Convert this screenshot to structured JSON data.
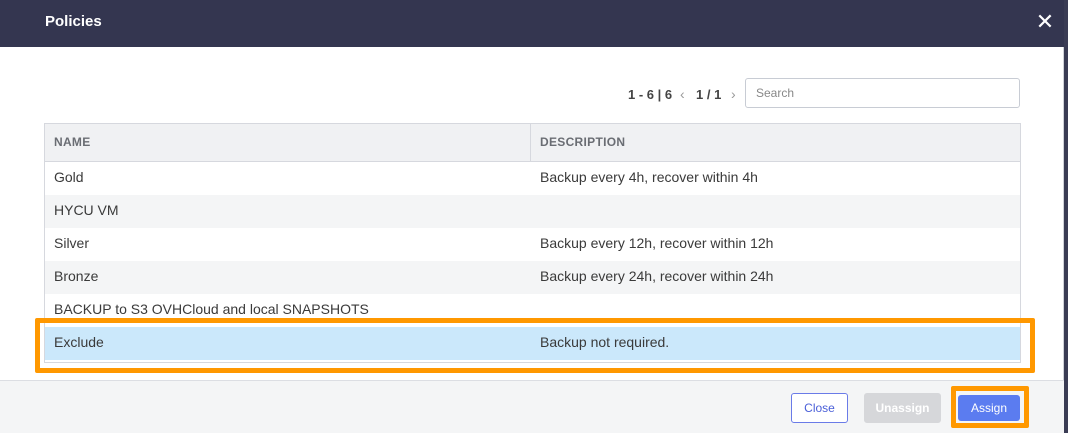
{
  "dialog": {
    "title": "Policies",
    "close_glyph": "✕"
  },
  "pager": {
    "range": "1 - 6 | 6",
    "prev_glyph": "‹",
    "page": "1 / 1",
    "next_glyph": "›"
  },
  "search": {
    "placeholder": "Search",
    "value": ""
  },
  "table": {
    "columns": [
      "NAME",
      "DESCRIPTION"
    ],
    "rows": [
      {
        "name": "Gold",
        "description": "Backup every 4h, recover within 4h"
      },
      {
        "name": "HYCU VM",
        "description": ""
      },
      {
        "name": "Silver",
        "description": "Backup every 12h, recover within 12h"
      },
      {
        "name": "Bronze",
        "description": "Backup every 24h, recover within 24h"
      },
      {
        "name": "BACKUP to S3 OVHCloud and local SNAPSHOTS",
        "description": ""
      },
      {
        "name": "Exclude",
        "description": "Backup not required."
      }
    ],
    "selected_index": 5
  },
  "footer": {
    "close_label": "Close",
    "unassign_label": "Unassign",
    "assign_label": "Assign"
  },
  "colors": {
    "header_bg": "#343650",
    "selected_row": "#cbe8fb",
    "highlight": "#ff9800",
    "primary": "#5b7cf0"
  }
}
